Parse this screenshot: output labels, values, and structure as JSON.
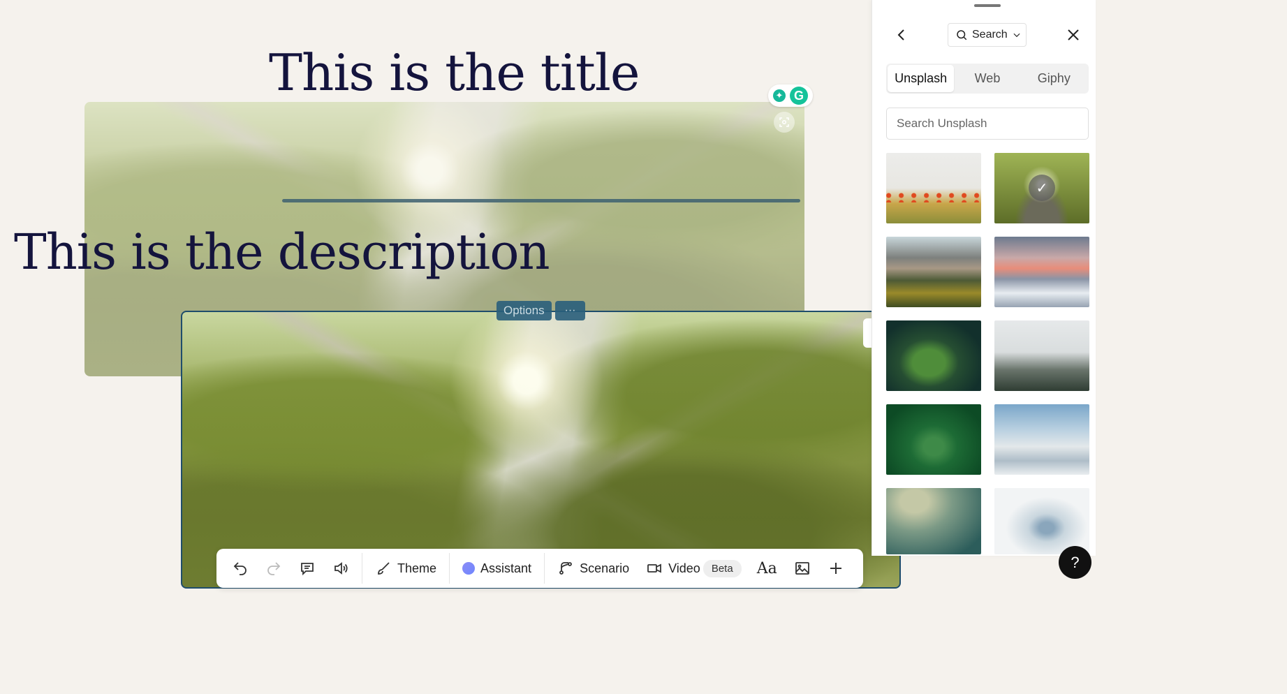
{
  "slide": {
    "title": "This is the title",
    "description": "This is the description",
    "options_label": "Options",
    "more_label": "···"
  },
  "toolbar": {
    "theme_label": "Theme",
    "assistant_label": "Assistant",
    "scenario_label": "Scenario",
    "video_label": "Video",
    "beta_label": "Beta",
    "font_label": "Aa"
  },
  "panel": {
    "search_dropdown_label": "Search",
    "tabs": [
      {
        "label": "Unsplash",
        "active": true
      },
      {
        "label": "Web",
        "active": false
      },
      {
        "label": "Giphy",
        "active": false
      }
    ],
    "search_placeholder": "Search Unsplash",
    "thumbnails": [
      {
        "name": "poppy-field",
        "selected": false
      },
      {
        "name": "tree-canopy-sunburst",
        "selected": true
      },
      {
        "name": "mountain-meadow",
        "selected": false
      },
      {
        "name": "pink-sky-clouds",
        "selected": false
      },
      {
        "name": "moss-sprout",
        "selected": false
      },
      {
        "name": "misty-forest",
        "selected": false
      },
      {
        "name": "leaf-water-drop",
        "selected": false
      },
      {
        "name": "sea-of-clouds",
        "selected": false
      },
      {
        "name": "dew-on-stem",
        "selected": false
      },
      {
        "name": "frosted-plant",
        "selected": false
      }
    ]
  },
  "help_label": "?"
}
